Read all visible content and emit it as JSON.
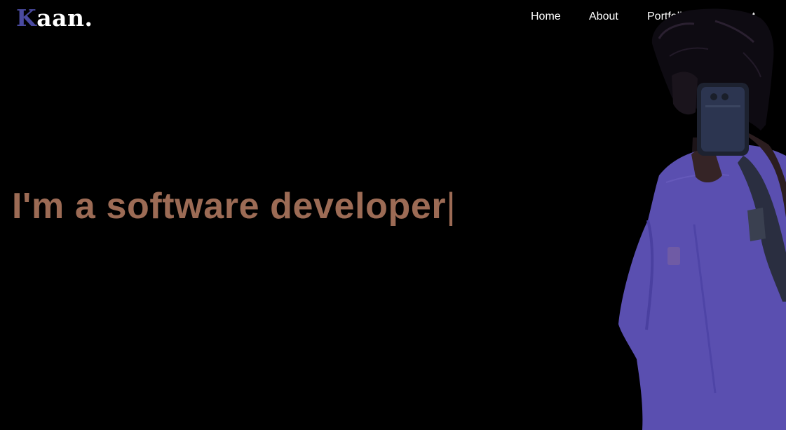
{
  "header": {
    "logo_initial": "K",
    "logo_rest": "aan."
  },
  "nav": {
    "items": [
      {
        "label": "Home"
      },
      {
        "label": "About"
      },
      {
        "label": "Portfolio"
      },
      {
        "label": "Contact"
      }
    ]
  },
  "hero": {
    "typed_text": "I'm a software developer",
    "cursor": "|"
  },
  "colors": {
    "background": "#000000",
    "logo_accent": "#4a4aa0",
    "hero_text": "#9c6b55",
    "nav_text": "#ffffff",
    "shirt": "#5a4fb0"
  },
  "photo": {
    "subject": "person taking mirror selfie with phone, purple t-shirt"
  }
}
